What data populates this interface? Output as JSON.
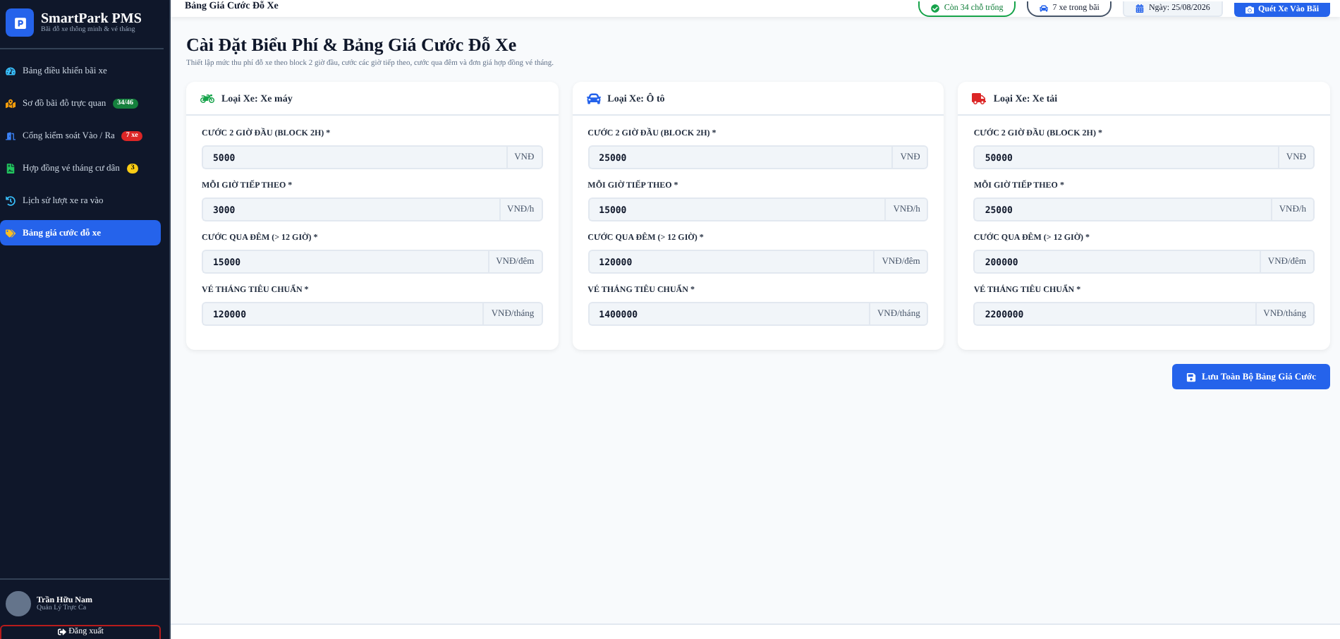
{
  "sidebar": {
    "brand": {
      "title": "SmartPark PMS",
      "subtitle": "Bãi đỗ xe thông minh & vé tháng"
    },
    "items": [
      {
        "label": "Bảng điều khiển bãi xe",
        "selected": false
      },
      {
        "label": "Sơ đồ bãi đỗ trực quan",
        "selected": false,
        "badge": {
          "text": "34/46",
          "color": "#15803d"
        }
      },
      {
        "label": "Cổng kiểm soát Vào / Ra",
        "selected": false,
        "badge": {
          "text": "7 xe",
          "color": "#dc2626"
        }
      },
      {
        "label": "Hợp đồng vé tháng cư dân",
        "selected": false,
        "badge": {
          "text": "3",
          "color": "#facc15"
        }
      },
      {
        "label": "Lịch sử lượt xe ra vào",
        "selected": false
      },
      {
        "label": "Bảng giá cước đỗ xe",
        "selected": true
      }
    ],
    "user": {
      "name": "Trần Hữu Nam",
      "role": "Quản Lý Trực Ca"
    },
    "logout": "Đăng xuất"
  },
  "header": {
    "title": "Bảng Giá Cước Đỗ Xe",
    "chips": [
      {
        "kind": "status",
        "label": "Còn 34 chỗ trống"
      },
      {
        "kind": "car",
        "label": "7 xe trong bãi"
      },
      {
        "kind": "date",
        "label": "Ngày: 25/08/2026"
      }
    ],
    "action": "Quét Xe Vào Bãi"
  },
  "page": {
    "title": "Cài Đặt Biểu Phí & Bảng Giá Cước Đỗ Xe",
    "subtitle": "Thiết lập mức thu phí đỗ xe theo block 2 giờ đầu, cước các giờ tiếp theo, cước qua đêm và đơn giá hợp đồng vé tháng."
  },
  "cards": [
    {
      "kind": "motorbike",
      "title": "Loại Xe: Xe máy",
      "fields": [
        {
          "label": "CƯỚC 2 GIỜ ĐẦU (BLOCK 2H) *",
          "value": "5000",
          "unit": "VNĐ"
        },
        {
          "label": "MỖI GIỜ TIẾP THEO *",
          "value": "3000",
          "unit": "VNĐ/h"
        },
        {
          "label": "CƯỚC QUA ĐÊM (> 12 GIỜ) *",
          "value": "15000",
          "unit": "VNĐ/đêm"
        },
        {
          "label": "VÉ THÁNG TIÊU CHUẨN *",
          "value": "120000",
          "unit": "VNĐ/tháng"
        }
      ]
    },
    {
      "kind": "car",
      "title": "Loại Xe: Ô tô",
      "fields": [
        {
          "label": "CƯỚC 2 GIỜ ĐẦU (BLOCK 2H) *",
          "value": "25000",
          "unit": "VNĐ"
        },
        {
          "label": "MỖI GIỜ TIẾP THEO *",
          "value": "15000",
          "unit": "VNĐ/h"
        },
        {
          "label": "CƯỚC QUA ĐÊM (> 12 GIỜ) *",
          "value": "120000",
          "unit": "VNĐ/đêm"
        },
        {
          "label": "VÉ THÁNG TIÊU CHUẨN *",
          "value": "1400000",
          "unit": "VNĐ/tháng"
        }
      ]
    },
    {
      "kind": "truck",
      "title": "Loại Xe: Xe tải",
      "fields": [
        {
          "label": "CƯỚC 2 GIỜ ĐẦU (BLOCK 2H) *",
          "value": "50000",
          "unit": "VNĐ"
        },
        {
          "label": "MỖI GIỜ TIẾP THEO *",
          "value": "25000",
          "unit": "VNĐ/h"
        },
        {
          "label": "CƯỚC QUA ĐÊM (> 12 GIỜ) *",
          "value": "200000",
          "unit": "VNĐ/đêm"
        },
        {
          "label": "VÉ THÁNG TIÊU CHUẨN *",
          "value": "2200000",
          "unit": "VNĐ/tháng"
        }
      ]
    }
  ],
  "save": "Lưu Toàn Bộ Bảng Giá Cước"
}
